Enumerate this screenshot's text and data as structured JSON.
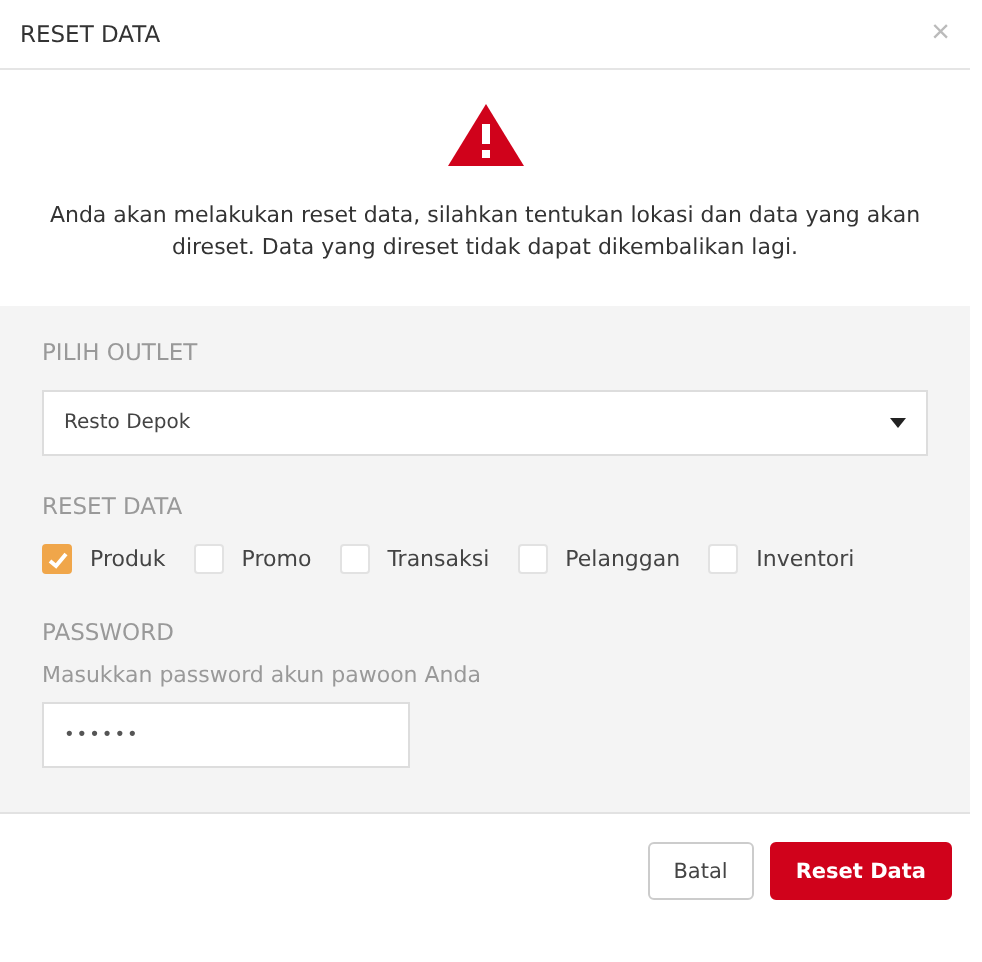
{
  "dialog": {
    "title": "RESET DATA",
    "close": "×"
  },
  "warning": {
    "message": "Anda akan melakukan reset data, silahkan tentukan lokasi dan data yang akan direset. Data yang direset tidak dapat dikembalikan lagi."
  },
  "outlet": {
    "label": "PILIH OUTLET",
    "value": "Resto Depok"
  },
  "reset_data": {
    "label": "RESET DATA",
    "options": [
      {
        "label": "Produk",
        "checked": true
      },
      {
        "label": "Promo",
        "checked": false
      },
      {
        "label": "Transaksi",
        "checked": false
      },
      {
        "label": "Pelanggan",
        "checked": false
      },
      {
        "label": "Inventori",
        "checked": false
      }
    ]
  },
  "password": {
    "label": "PASSWORD",
    "hint": "Masukkan password akun pawoon Anda",
    "value": "••••••"
  },
  "buttons": [
    {
      "label": "Batal",
      "kind": "secondary"
    },
    {
      "label": "Reset Data",
      "kind": "primary"
    }
  ]
}
